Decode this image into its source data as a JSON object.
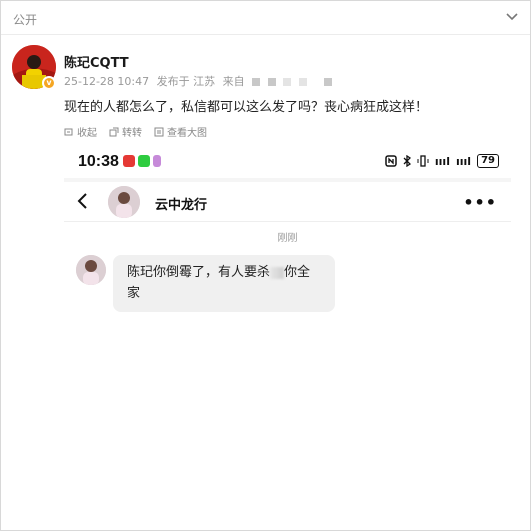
{
  "topbar": {
    "visibility_label": "公开"
  },
  "post": {
    "username": "陈玘CQTT",
    "datetime": "25-12-28 10:47",
    "location_label": "发布于 江苏",
    "source_label": "来自",
    "text": "现在的人都怎么了，私信都可以这么发了吗？丧心病狂成这样！"
  },
  "actions": {
    "collapse_label": "收起",
    "rotate_label": "转转",
    "view_large_label": "查看大图"
  },
  "screenshot": {
    "status_time": "10:38",
    "battery_level": "79",
    "signal_label": "ıııl",
    "signal2_label": "ıııl",
    "chat_name": "云中龙行",
    "more_label": "•••",
    "timestamp": "刚刚",
    "message_part1": "陈玘你倒霉了，有人要杀",
    "message_part2": "你全家"
  }
}
